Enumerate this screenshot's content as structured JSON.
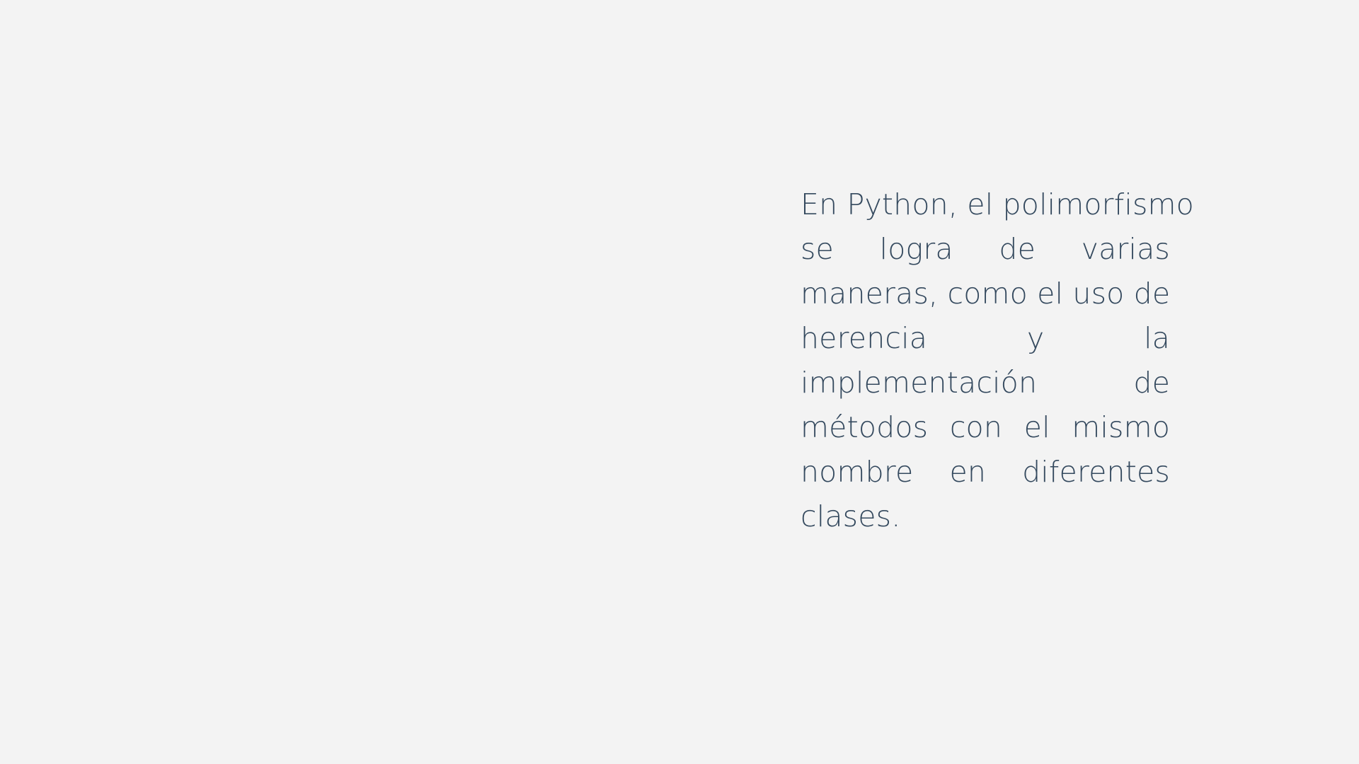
{
  "slide": {
    "colors": {
      "background": "#f3f3f3",
      "text": "#34495e"
    },
    "paragraph": {
      "lines": [
        "En Python, el polimorfismo",
        "se logra de varias",
        "maneras, como el uso de",
        "herencia y la",
        "implementación de",
        "métodos con el mismo",
        "nombre en diferentes",
        "clases."
      ]
    }
  }
}
